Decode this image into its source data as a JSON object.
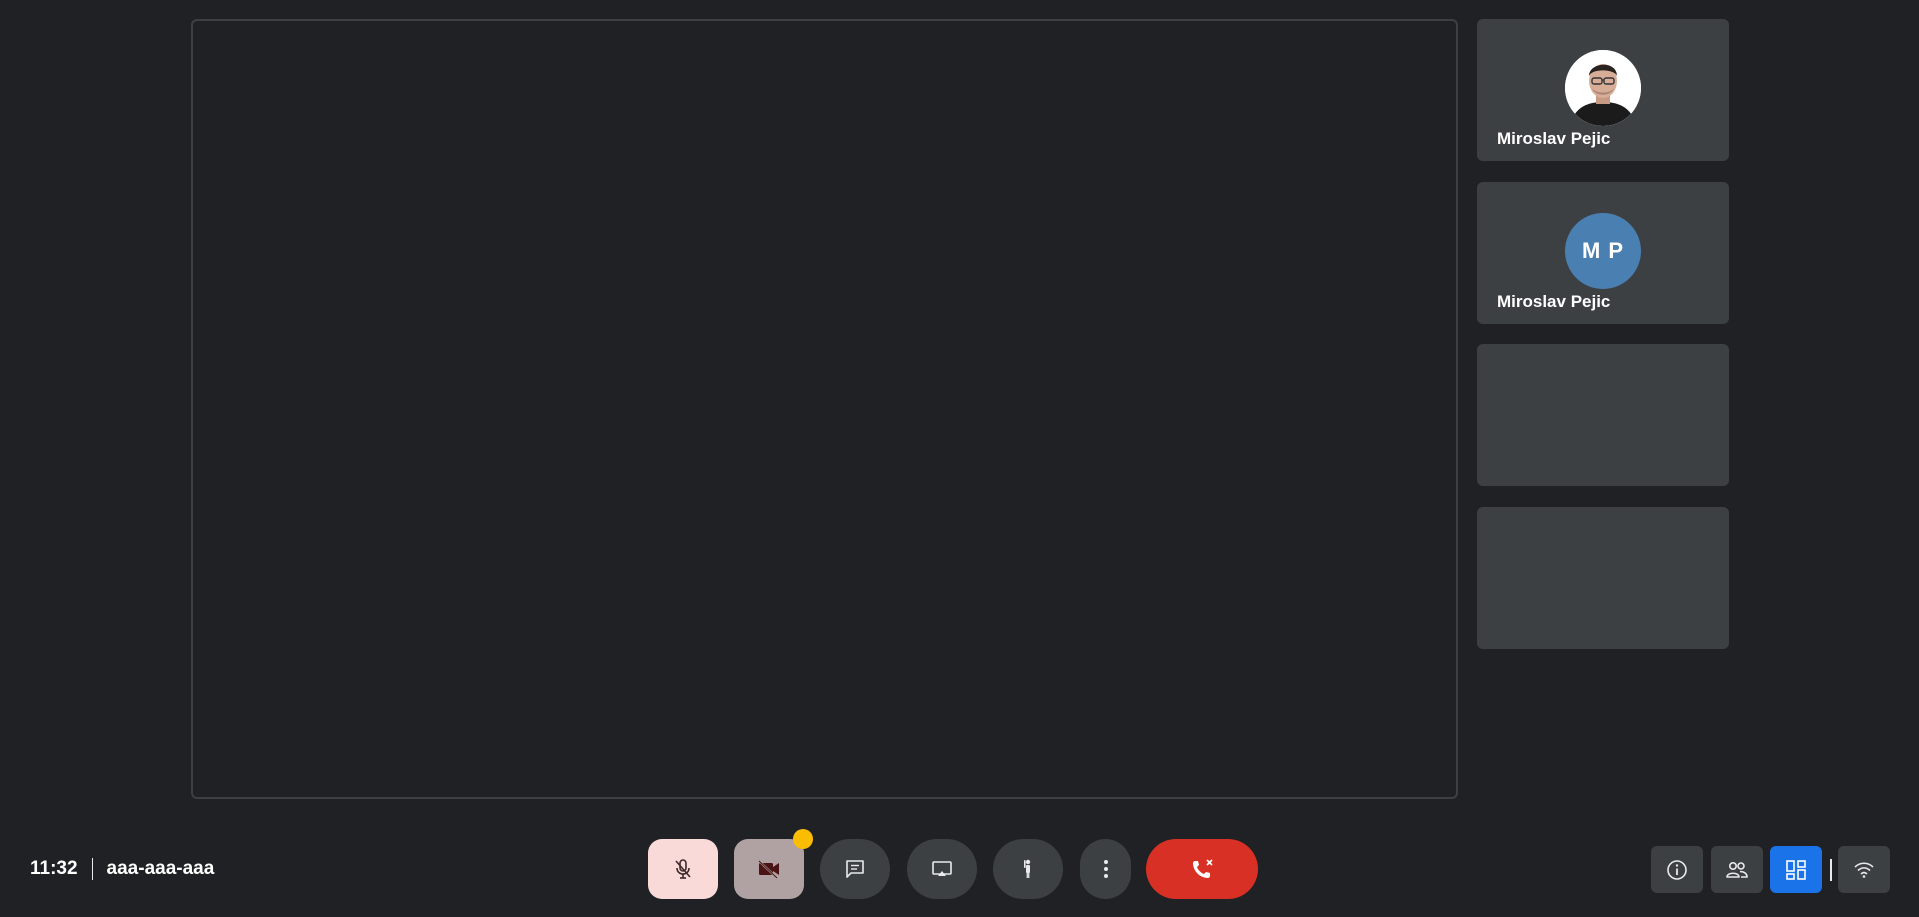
{
  "meeting": {
    "time": "11:32",
    "code": "aaa-aaa-aaa"
  },
  "participants": [
    {
      "name": "Miroslav Pejic",
      "avatar": "photo"
    },
    {
      "name": "Miroslav Pejic",
      "initials": "M P",
      "avatar_color": "#4a7fb1"
    },
    {
      "name": ""
    },
    {
      "name": ""
    }
  ],
  "controls": {
    "mic": {
      "icon": "mic-off-icon",
      "state": "off"
    },
    "camera": {
      "icon": "camera-off-icon",
      "state": "off",
      "badge_color": "#fbbc04"
    },
    "chat": {
      "icon": "chat-icon"
    },
    "present": {
      "icon": "present-screen-icon"
    },
    "raise_hand": {
      "icon": "raise-hand-icon"
    },
    "more": {
      "icon": "more-vert-icon"
    },
    "end_call": {
      "icon": "end-call-icon",
      "color": "#d93025"
    }
  },
  "right_controls": {
    "info": {
      "icon": "info-icon"
    },
    "people": {
      "icon": "people-icon"
    },
    "layout": {
      "icon": "layout-grid-icon",
      "active": true,
      "color": "#1a73e8"
    },
    "network": {
      "icon": "wifi-icon"
    }
  },
  "colors": {
    "background": "#202124",
    "tile": "#3c4043"
  }
}
